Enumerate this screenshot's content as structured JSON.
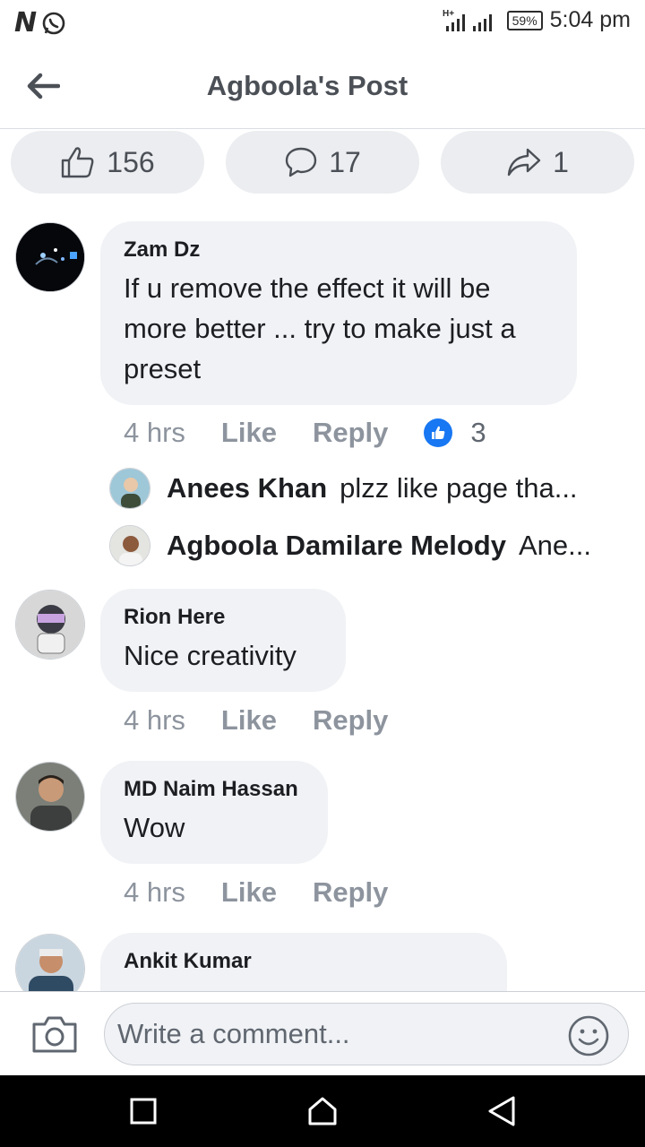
{
  "status_bar": {
    "left_icons": [
      "n-icon",
      "whatsapp-icon"
    ],
    "network": "H+",
    "battery": "59%",
    "time": "5:04 pm"
  },
  "header": {
    "title": "Agboola's Post"
  },
  "reactions": {
    "likes": "156",
    "comments": "17",
    "shares": "1"
  },
  "comments": [
    {
      "name": "Zam Dz",
      "text": "If u remove the effect it will be more better ... try to make just a preset",
      "time": "4 hrs",
      "like_label": "Like",
      "reply_label": "Reply",
      "reaction_count": "3",
      "replies": [
        {
          "name": "Anees Khan",
          "text": "plzz like page tha..."
        },
        {
          "name": "Agboola Damilare Melody",
          "text": "Ane..."
        }
      ]
    },
    {
      "name": "Rion Here",
      "text": "Nice creativity",
      "time": "4 hrs",
      "like_label": "Like",
      "reply_label": "Reply"
    },
    {
      "name": "MD Naim Hassan",
      "text": "Wow",
      "time": "4 hrs",
      "like_label": "Like",
      "reply_label": "Reply"
    },
    {
      "name": "Ankit Kumar"
    }
  ],
  "composer": {
    "placeholder": "Write a comment..."
  },
  "nav": {
    "buttons": [
      "recents-icon",
      "home-icon",
      "back-icon"
    ]
  },
  "colors": {
    "accent": "#1877f2",
    "bubble": "#f0f2f5",
    "pill": "#ebedf0",
    "muted_text": "#8d949e"
  }
}
